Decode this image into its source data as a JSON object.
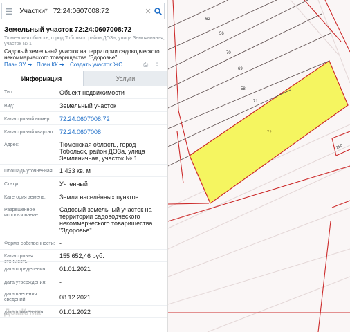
{
  "search": {
    "layer": "Участки",
    "query": "72:24:0607008:72"
  },
  "parcel": {
    "title": "Земельный участок 72:24:0607008:72",
    "address_small": "Тюменская область, город Тобольск, район ДОЗа, улица Земляничная, участок № 1",
    "description": "Садовый земельный участок на территории садоводческого некоммерческого товарищества \"Здоровье\""
  },
  "links": {
    "plan_zu": "План ЗУ",
    "plan_kk": "План КК",
    "create_plan": "Создать участок ЖС"
  },
  "tabs": {
    "info": "Информация",
    "services": "Услуги"
  },
  "properties": {
    "type_label": "Тип:",
    "type_value": "Объект недвижимости",
    "kind_label": "Вид:",
    "kind_value": "Земельный участок",
    "cadnum_label": "Кадастровый номер:",
    "cadnum_value": "72:24:0607008:72",
    "quarter_label": "Кадастровый квартал:",
    "quarter_value": "72:24:0607008",
    "address_label": "Адрес:",
    "address_value": "Тюменская область, город Тобольск, район ДОЗа, улица Земляничная, участок № 1",
    "area_label": "Площадь уточненная:",
    "area_value": "1 433 кв. м",
    "status_label": "Статус:",
    "status_value": "Учтенный",
    "category_label": "Категория земель:",
    "category_value": "Земли населённых пунктов",
    "use_label": "Разрешенное использование:",
    "use_value": "Садовый земельный участок на территории садоводческого некоммерческого товарищества \"Здоровье\"",
    "ownership_label": "Форма собственности:",
    "ownership_value": "-",
    "cost_label": "Кадастровая стоимость:",
    "cost_value": "155 652,46 руб.",
    "det_date_label": "дата определения:",
    "det_date_value": "01.01.2021",
    "appr_date_label": "дата утверждения:",
    "appr_date_value": "-",
    "entry_date_label": "дата внесения сведений:",
    "entry_date_value": "08.12.2021",
    "apply_date_label": "дата применения:",
    "apply_date_value": "01.01.2022"
  },
  "map": {
    "parcel_labels": [
      "62",
      "56",
      "70",
      "69",
      "58",
      "71",
      "72",
      "250"
    ],
    "highlight_color": "#f5f560",
    "boundary_color": "#cc2a2a"
  },
  "watermark": "ДомКлик"
}
